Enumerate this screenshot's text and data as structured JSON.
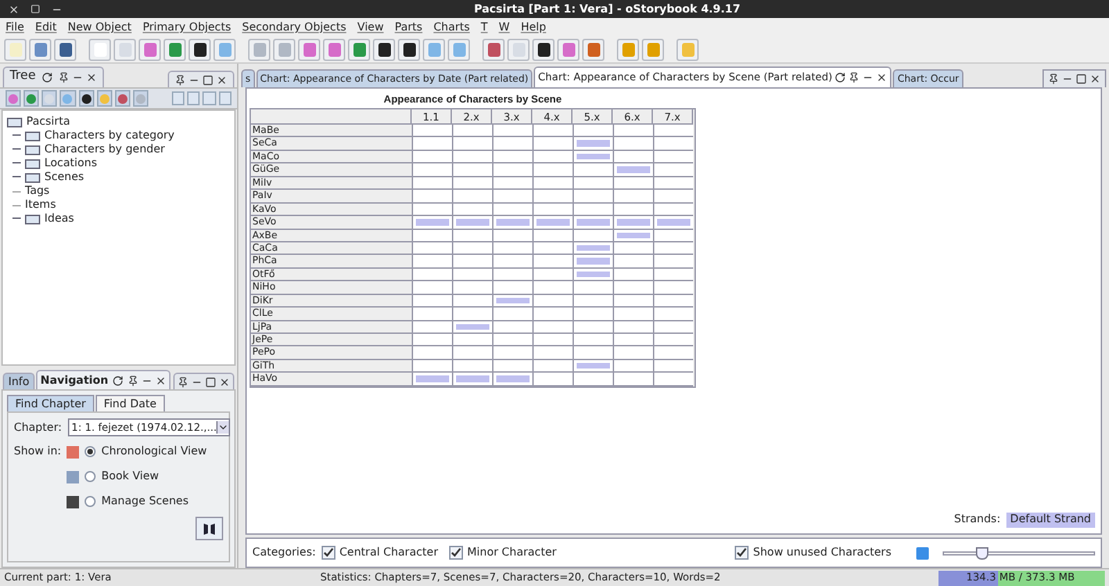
{
  "window": {
    "title": "Pacsirta [Part 1: Vera] - oStorybook 4.9.17"
  },
  "menu": [
    "File",
    "Edit",
    "New Object",
    "Primary Objects",
    "Secondary Objects",
    "View",
    "Parts",
    "Charts",
    "T",
    "W",
    "Help"
  ],
  "tree": {
    "tab": "Tree",
    "root": "Pacsirta",
    "children": [
      {
        "label": "Characters by category",
        "kind": "folder"
      },
      {
        "label": "Characters by gender",
        "kind": "folder"
      },
      {
        "label": "Locations",
        "kind": "folder"
      },
      {
        "label": "Scenes",
        "kind": "folder"
      },
      {
        "label": "Tags",
        "kind": "leaf"
      },
      {
        "label": "Items",
        "kind": "leaf"
      },
      {
        "label": "Ideas",
        "kind": "folder"
      }
    ]
  },
  "navigation": {
    "tabs": [
      {
        "label": "Info",
        "selected": false
      },
      {
        "label": "Navigation",
        "selected": true
      }
    ],
    "subtabs": [
      {
        "label": "Find Chapter",
        "selected": true
      },
      {
        "label": "Find Date",
        "selected": false
      }
    ],
    "chapter_label": "Chapter:",
    "chapter_value": "1: 1. fejezet (1974.02.12.,...",
    "show_in_label": "Show in:",
    "views": [
      {
        "label": "Chronological View",
        "selected": true
      },
      {
        "label": "Book View",
        "selected": false
      },
      {
        "label": "Manage Scenes",
        "selected": false
      }
    ]
  },
  "chart_tabs": [
    {
      "label": "s",
      "selected": false
    },
    {
      "label": "Chart: Appearance of Characters by Date (Part related)",
      "selected": false
    },
    {
      "label": "Chart: Appearance of Characters by Scene (Part related)",
      "selected": true
    },
    {
      "label": "Chart: Occur",
      "selected": false
    }
  ],
  "chart": {
    "title": "Appearance of Characters by Scene",
    "columns": [
      "1.1",
      "2.x",
      "3.x",
      "4.x",
      "5.x",
      "6.x",
      "7.x"
    ],
    "rows": [
      {
        "name": "MaBe",
        "cells": [
          false,
          false,
          false,
          false,
          false,
          false,
          false
        ]
      },
      {
        "name": "SeCa",
        "cells": [
          false,
          false,
          false,
          false,
          true,
          false,
          false
        ]
      },
      {
        "name": "MaCo",
        "cells": [
          false,
          false,
          false,
          false,
          true,
          false,
          false
        ]
      },
      {
        "name": "GüGe",
        "cells": [
          false,
          false,
          false,
          false,
          false,
          true,
          false
        ]
      },
      {
        "name": "MiIv",
        "cells": [
          false,
          false,
          false,
          false,
          false,
          false,
          false
        ]
      },
      {
        "name": "PaIv",
        "cells": [
          false,
          false,
          false,
          false,
          false,
          false,
          false
        ]
      },
      {
        "name": "KaVo",
        "cells": [
          false,
          false,
          false,
          false,
          false,
          false,
          false
        ]
      },
      {
        "name": "SeVo",
        "cells": [
          true,
          true,
          true,
          true,
          true,
          true,
          true
        ]
      },
      {
        "name": "AxBe",
        "cells": [
          false,
          false,
          false,
          false,
          false,
          true,
          false
        ]
      },
      {
        "name": "CaCa",
        "cells": [
          false,
          false,
          false,
          false,
          true,
          false,
          false
        ]
      },
      {
        "name": "PhCa",
        "cells": [
          false,
          false,
          false,
          false,
          true,
          false,
          false
        ]
      },
      {
        "name": "OtFő",
        "cells": [
          false,
          false,
          false,
          false,
          true,
          false,
          false
        ]
      },
      {
        "name": "NiHo",
        "cells": [
          false,
          false,
          false,
          false,
          false,
          false,
          false
        ]
      },
      {
        "name": "DiKr",
        "cells": [
          false,
          false,
          true,
          false,
          false,
          false,
          false
        ]
      },
      {
        "name": "ClLe",
        "cells": [
          false,
          false,
          false,
          false,
          false,
          false,
          false
        ]
      },
      {
        "name": "LjPa",
        "cells": [
          false,
          true,
          false,
          false,
          false,
          false,
          false
        ]
      },
      {
        "name": "JePe",
        "cells": [
          false,
          false,
          false,
          false,
          false,
          false,
          false
        ]
      },
      {
        "name": "PePo",
        "cells": [
          false,
          false,
          false,
          false,
          false,
          false,
          false
        ]
      },
      {
        "name": "GiTh",
        "cells": [
          false,
          false,
          false,
          false,
          true,
          false,
          false
        ]
      },
      {
        "name": "HaVo",
        "cells": [
          true,
          true,
          true,
          false,
          false,
          false,
          false
        ]
      }
    ],
    "strands_label": "Strands:",
    "strand": "Default Strand"
  },
  "options": {
    "categories_label": "Categories:",
    "checks": [
      {
        "label": "Central Character",
        "checked": true
      },
      {
        "label": "Minor Character",
        "checked": true
      }
    ],
    "show_unused": {
      "label": "Show unused Characters",
      "checked": true
    },
    "zoom": {
      "level": 0.25
    }
  },
  "status_bar": {
    "current_part": "Current part: 1: Vera",
    "statistics": "Statistics: Chapters=7,  Scenes=7,  Characters=20,  Characters=10,  Words=2",
    "memory": {
      "text": "134.3 MB / 373.3 MB",
      "level": 0.36
    }
  }
}
